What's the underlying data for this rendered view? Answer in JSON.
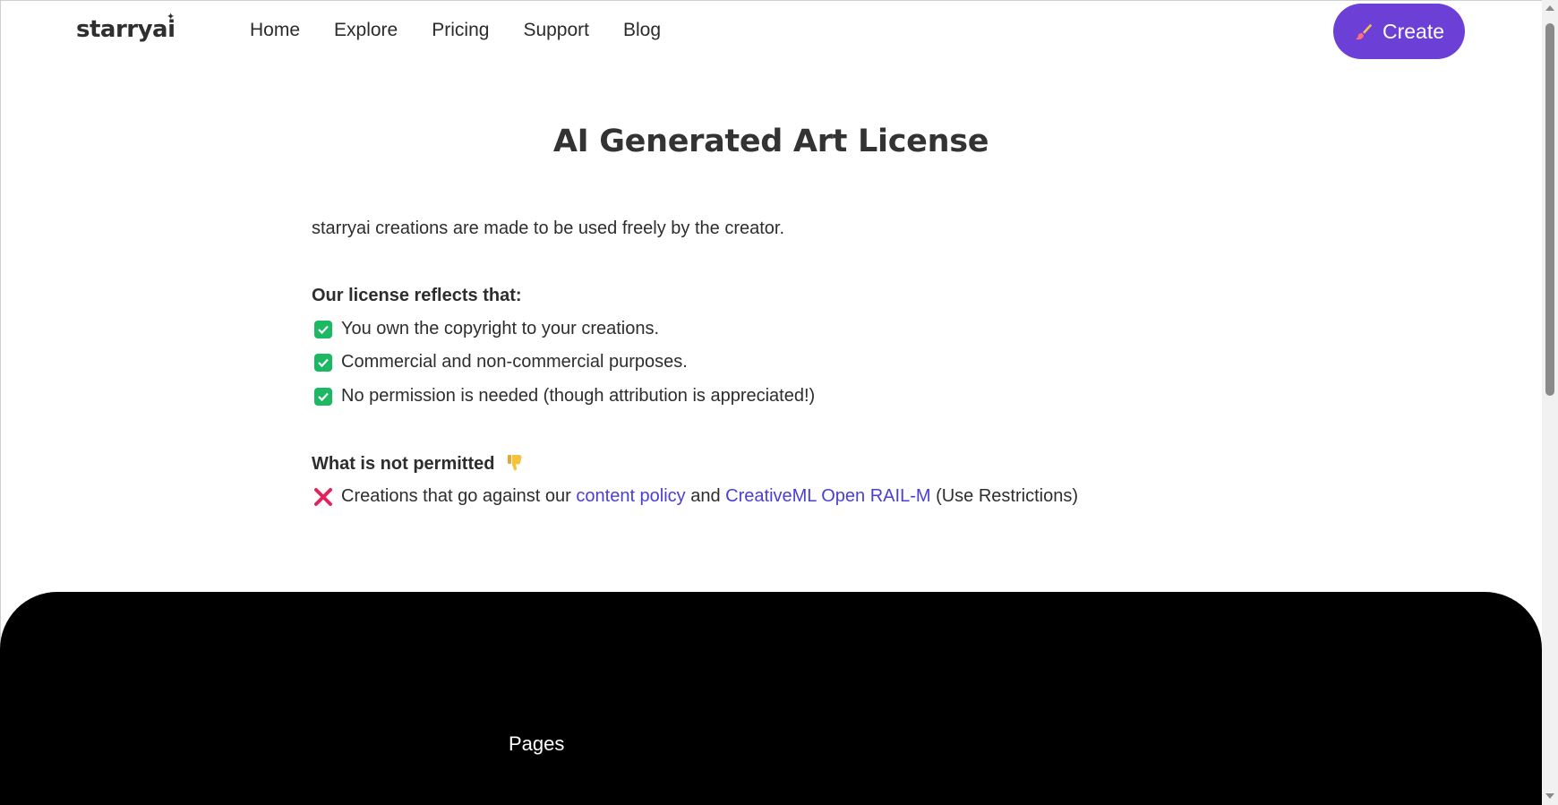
{
  "header": {
    "logo": "starryai",
    "nav": [
      "Home",
      "Explore",
      "Pricing",
      "Support",
      "Blog"
    ],
    "create_label": "Create"
  },
  "main": {
    "title": "AI Generated Art License",
    "intro": "starryai creations are made to be used freely by the creator.",
    "license_heading": "Our license reflects that:",
    "permitted": [
      "You own the copyright to your creations.",
      "Commercial and non-commercial purposes.",
      "No permission is needed (though attribution is appreciated!)"
    ],
    "not_permitted_heading": "What is not permitted",
    "restriction": {
      "prefix": "Creations that go against our ",
      "link1": "content policy",
      "middle": " and ",
      "link2": "CreativeML Open RAIL-M",
      "suffix": " (Use Restrictions)"
    }
  },
  "footer": {
    "pages_heading": "Pages"
  },
  "colors": {
    "accent": "#6c3fd6",
    "link": "#4a3fd4",
    "check": "#1cb864",
    "cross": "#e0245e"
  }
}
